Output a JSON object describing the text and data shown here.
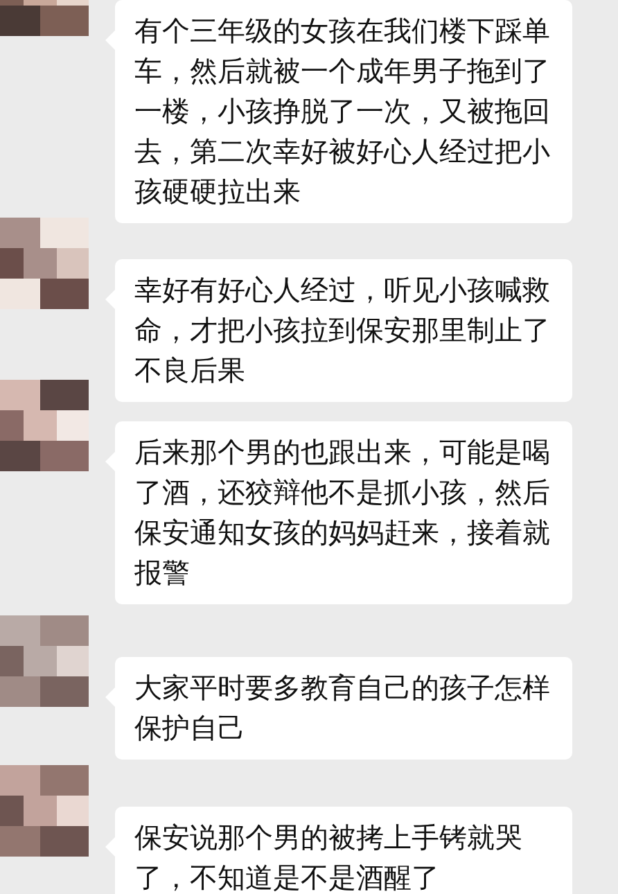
{
  "messages": [
    {
      "text": "有个三年级的女孩在我们楼下踩单车，然后就被一个成年男子拖到了一楼，小孩挣脱了一次，又被拖回去，第二次幸好被好心人经过把小孩硬硬拉出来"
    },
    {
      "text": "幸好有好心人经过，听见小孩喊救命，才把小孩拉到保安那里制止了不良后果"
    },
    {
      "text": "后来那个男的也跟出来，可能是喝了酒，还狡辩他不是抓小孩，然后保安通知女孩的妈妈赶来，接着就报警"
    },
    {
      "text": "大家平时要多教育自己的孩子怎样保护自己"
    },
    {
      "text": "保安说那个男的被拷上手铐就哭了，不知道是不是酒醒了"
    }
  ]
}
